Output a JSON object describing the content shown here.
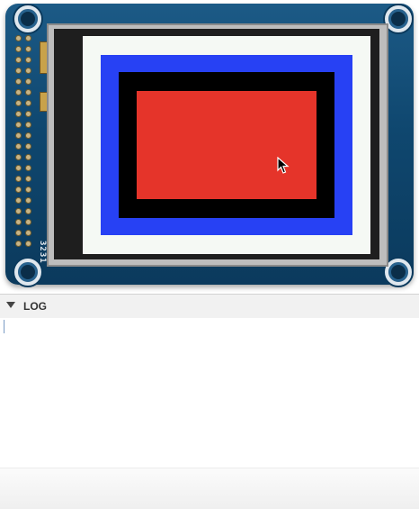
{
  "device": {
    "silkscreen_text": "3231",
    "screen": {
      "background_color": "#f5f9f4",
      "outer_rect_color": "#2741f4",
      "middle_rect_color": "#000000",
      "inner_rect_color": "#e5342a"
    },
    "board_color": "#0f476f"
  },
  "log_panel": {
    "title": "LOG",
    "expanded": true,
    "content": ""
  }
}
